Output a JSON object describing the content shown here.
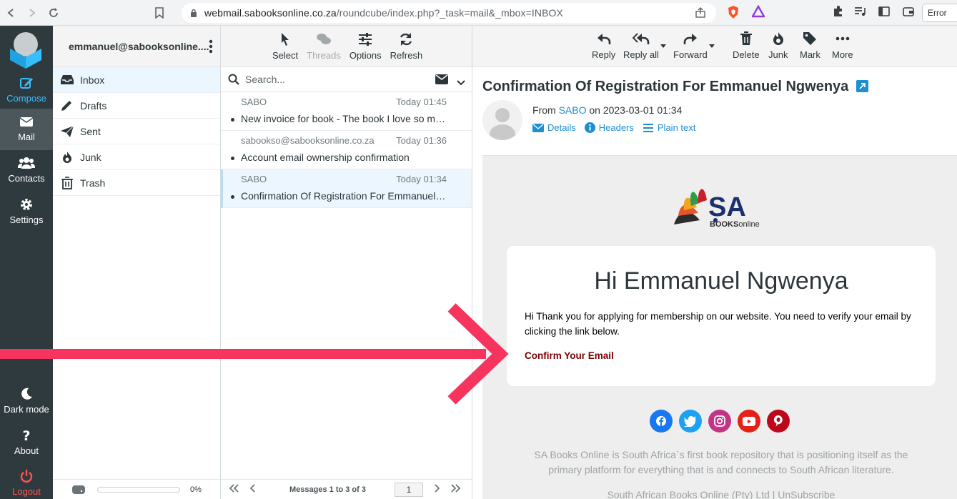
{
  "browser": {
    "url_host": "webmail.sabooksonline.co.za",
    "url_path": "/roundcube/index.php?_task=mail&_mbox=INBOX",
    "error_label": "Error"
  },
  "appnav": {
    "compose": "Compose",
    "mail": "Mail",
    "contacts": "Contacts",
    "settings": "Settings",
    "dark_mode": "Dark mode",
    "about": "About",
    "logout": "Logout"
  },
  "folders": {
    "account": "emmanuel@sabooksonline....",
    "items": [
      {
        "label": "Inbox",
        "icon": "inbox-icon"
      },
      {
        "label": "Drafts",
        "icon": "pencil-icon"
      },
      {
        "label": "Sent",
        "icon": "paper-plane-icon"
      },
      {
        "label": "Junk",
        "icon": "fire-icon"
      },
      {
        "label": "Trash",
        "icon": "trash-icon"
      }
    ],
    "quota_percent": "0%"
  },
  "list_toolbar": {
    "select": "Select",
    "threads": "Threads",
    "options": "Options",
    "refresh": "Refresh"
  },
  "search": {
    "placeholder": "Search..."
  },
  "messages": [
    {
      "from": "SABO",
      "date": "Today 01:45",
      "subject": "New invoice for book - The book I love so much"
    },
    {
      "from": "sabookso@sabooksonline.co.za",
      "date": "Today 01:36",
      "subject": "Account email ownership confirmation"
    },
    {
      "from": "SABO",
      "date": "Today 01:34",
      "subject": "Confirmation Of Registration For Emmanuel Ngwenya"
    }
  ],
  "list_footer": {
    "count": "Messages 1 to 3 of 3",
    "page": "1"
  },
  "preview_toolbar": {
    "reply": "Reply",
    "reply_all": "Reply all",
    "forward": "Forward",
    "delete": "Delete",
    "junk": "Junk",
    "mark": "Mark",
    "more": "More"
  },
  "email": {
    "subject": "Confirmation Of Registration For Emmanuel Ngwenya",
    "from_prefix": "From",
    "from_name": "SABO",
    "date": "on 2023-03-01 01:34",
    "details": "Details",
    "headers": "Headers",
    "plain_text": "Plain text",
    "logo_text": "SA",
    "logo_sub_bold": "BOOKS",
    "logo_sub": "online",
    "greeting": "Hi Emmanuel Ngwenya",
    "paragraph": "Hi Thank you for applying for membership on our website. You need to verify your email by clicking the link below.",
    "cta": "Confirm Your Email",
    "footer": "SA Books Online is South Africa`s first book repository that is positioning itself as the primary platform for everything that is and connects to South African literature.",
    "footer2": "South African Books Online (Pty) Ltd | UnSubscribe"
  },
  "colors": {
    "accent": "#37beff",
    "link": "#1c8ed1",
    "nav_bg": "#2f3a3f",
    "cta": "#7b0000",
    "annotation_arrow": "#f7345e"
  }
}
